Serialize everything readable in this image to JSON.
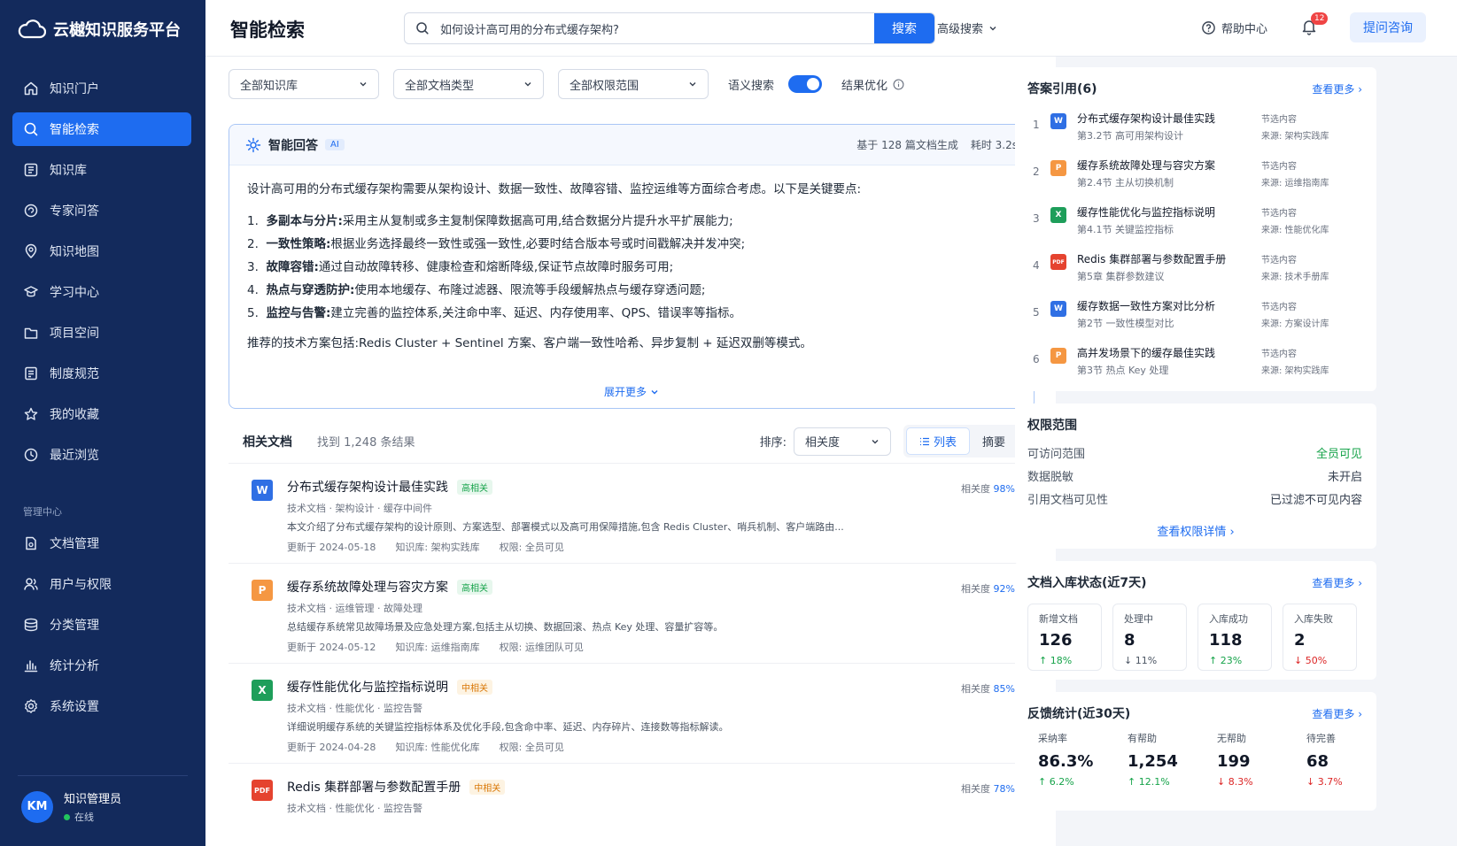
{
  "sidebar": {
    "logo": "云樾知识服务平台",
    "items": [
      {
        "label": "知识门户",
        "icon": "home-icon"
      },
      {
        "label": "智能检索",
        "icon": "search-icon",
        "active": true
      },
      {
        "label": "知识库",
        "icon": "library-icon"
      },
      {
        "label": "专家问答",
        "icon": "chat-icon"
      },
      {
        "label": "知识地图",
        "icon": "map-pin-icon"
      },
      {
        "label": "学习中心",
        "icon": "graduation-icon"
      },
      {
        "label": "项目空间",
        "icon": "folder-icon"
      },
      {
        "label": "制度规范",
        "icon": "document-icon"
      },
      {
        "label": "我的收藏",
        "icon": "star-icon"
      },
      {
        "label": "最近浏览",
        "icon": "clock-icon"
      }
    ],
    "admin_section": "管理中心",
    "admin_items": [
      {
        "label": "文档管理",
        "icon": "file-manage-icon"
      },
      {
        "label": "用户与权限",
        "icon": "users-icon"
      },
      {
        "label": "分类管理",
        "icon": "layers-icon"
      },
      {
        "label": "统计分析",
        "icon": "bar-chart-icon"
      },
      {
        "label": "系统设置",
        "icon": "gear-icon"
      }
    ],
    "user": {
      "initials": "KM",
      "name": "知识管理员",
      "status": "在线"
    }
  },
  "header": {
    "title": "智能检索",
    "search_value": "如何设计高可用的分布式缓存架构?",
    "search_button": "搜索",
    "advanced": "高级搜索",
    "help": "帮助中心",
    "notif_count": "12",
    "ask_button": "提问咨询"
  },
  "filters": {
    "kb": "全部知识库",
    "doc_type": "全部文档类型",
    "scope": "全部权限范围",
    "semantic": "语义搜索",
    "optimize": "结果优化"
  },
  "ai_answer": {
    "title": "智能回答",
    "tag": "AI",
    "basis": "基于 128 篇文档生成",
    "time": "耗时 3.2s",
    "intro": "设计高可用的分布式缓存架构需要从架构设计、数据一致性、故障容错、监控运维等方面综合考虑。以下是关键要点:",
    "points": [
      {
        "num": "1.",
        "head": "多副本与分片:",
        "text": "采用主从复制或多主复制保障数据高可用,结合数据分片提升水平扩展能力;"
      },
      {
        "num": "2.",
        "head": "一致性策略:",
        "text": "根据业务选择最终一致性或强一致性,必要时结合版本号或时间戳解决并发冲突;"
      },
      {
        "num": "3.",
        "head": "故障容错:",
        "text": "通过自动故障转移、健康检查和熔断降级,保证节点故障时服务可用;"
      },
      {
        "num": "4.",
        "head": "热点与穿透防护:",
        "text": "使用本地缓存、布隆过滤器、限流等手段缓解热点与缓存穿透问题;"
      },
      {
        "num": "5.",
        "head": "监控与告警:",
        "text": "建立完善的监控体系,关注命中率、延迟、内存使用率、QPS、错误率等指标。"
      }
    ],
    "summary": "推荐的技术方案包括:Redis Cluster + Sentinel 方案、客户端一致性哈希、异步复制 + 延迟双删等模式。",
    "expand": "展开更多"
  },
  "docs": {
    "title": "相关文档",
    "count": "找到 1,248 条结果",
    "sort_label": "排序:",
    "sort_value": "相关度",
    "view_list": "列表",
    "view_summary": "摘要",
    "rows": [
      {
        "type": "W",
        "color": "#2f6fe4",
        "title": "分布式缓存架构设计最佳实践",
        "rel": "高相关",
        "rel_level": "high",
        "tags": "技术文档 · 架构设计 · 缓存中间件",
        "desc": "本文介绍了分布式缓存架构的设计原则、方案选型、部署模式以及高可用保障措施,包含 Redis Cluster、哨兵机制、客户端路由...",
        "updated": "更新于 2024-05-18",
        "kb": "知识库: 架构实践库",
        "perm": "权限: 全员可见",
        "score_label": "相关度",
        "score": "98%"
      },
      {
        "type": "P",
        "color": "#f59742",
        "title": "缓存系统故障处理与容灾方案",
        "rel": "高相关",
        "rel_level": "high",
        "tags": "技术文档 · 运维管理 · 故障处理",
        "desc": "总结缓存系统常见故障场景及应急处理方案,包括主从切换、数据回滚、热点 Key 处理、容量扩容等。",
        "updated": "更新于 2024-05-12",
        "kb": "知识库: 运维指南库",
        "perm": "权限: 运维团队可见",
        "score_label": "相关度",
        "score": "92%"
      },
      {
        "type": "X",
        "color": "#1e9e5a",
        "title": "缓存性能优化与监控指标说明",
        "rel": "中相关",
        "rel_level": "mid",
        "tags": "技术文档 · 性能优化 · 监控告警",
        "desc": "详细说明缓存系统的关键监控指标体系及优化手段,包含命中率、延迟、内存碎片、连接数等指标解读。",
        "updated": "更新于 2024-04-28",
        "kb": "知识库: 性能优化库",
        "perm": "权限: 全员可见",
        "score_label": "相关度",
        "score": "85%"
      },
      {
        "type": "PDF",
        "color": "#e5432f",
        "title": "Redis 集群部署与参数配置手册",
        "rel": "中相关",
        "rel_level": "mid",
        "tags": "技术文档 · 性能优化 · 监控告警",
        "desc": "",
        "updated": "",
        "kb": "",
        "perm": "",
        "score_label": "相关度",
        "score": "78%"
      }
    ]
  },
  "citations": {
    "title": "答案引用(6)",
    "more": "查看更多",
    "items": [
      {
        "num": "1",
        "type": "W",
        "color": "#2f6fe4",
        "title": "分布式缓存架构设计最佳实践",
        "sub": "第3.2节 高可用架构设计",
        "label": "节选内容",
        "source": "来源: 架构实践库"
      },
      {
        "num": "2",
        "type": "P",
        "color": "#f59742",
        "title": "缓存系统故障处理与容灾方案",
        "sub": "第2.4节 主从切换机制",
        "label": "节选内容",
        "source": "来源: 运维指南库"
      },
      {
        "num": "3",
        "type": "X",
        "color": "#1e9e5a",
        "title": "缓存性能优化与监控指标说明",
        "sub": "第4.1节 关键监控指标",
        "label": "节选内容",
        "source": "来源: 性能优化库"
      },
      {
        "num": "4",
        "type": "PDF",
        "color": "#e5432f",
        "title": "Redis 集群部署与参数配置手册",
        "sub": "第5章 集群参数建议",
        "label": "节选内容",
        "source": "来源: 技术手册库"
      },
      {
        "num": "5",
        "type": "W",
        "color": "#2f6fe4",
        "title": "缓存数据一致性方案对比分析",
        "sub": "第2节 一致性模型对比",
        "label": "节选内容",
        "source": "来源: 方案设计库"
      },
      {
        "num": "6",
        "type": "P",
        "color": "#f59742",
        "title": "高并发场景下的缓存最佳实践",
        "sub": "第3节 热点 Key 处理",
        "label": "节选内容",
        "source": "来源: 架构实践库"
      }
    ]
  },
  "permission": {
    "title": "权限范围",
    "rows": [
      {
        "label": "可访问范围",
        "value": "全员可见",
        "ok": true
      },
      {
        "label": "数据脱敏",
        "value": "未开启"
      },
      {
        "label": "引用文档可见性",
        "value": "已过滤不可见内容"
      }
    ],
    "link": "查看权限详情"
  },
  "ingest": {
    "title": "文档入库状态(近7天)",
    "more": "查看更多",
    "stats": [
      {
        "label": "新增文档",
        "value": "126",
        "delta": "↑ 18%",
        "dir": "up"
      },
      {
        "label": "处理中",
        "value": "8",
        "delta": "↓ 11%",
        "dir": "down-gray"
      },
      {
        "label": "入库成功",
        "value": "118",
        "delta": "↑ 23%",
        "dir": "up"
      },
      {
        "label": "入库失败",
        "value": "2",
        "delta": "↓ 50%",
        "dir": "down"
      }
    ]
  },
  "feedback": {
    "title": "反馈统计(近30天)",
    "more": "查看更多",
    "stats": [
      {
        "label": "采纳率",
        "value": "86.3%",
        "delta": "↑ 6.2%",
        "dir": "up"
      },
      {
        "label": "有帮助",
        "value": "1,254",
        "delta": "↑ 12.1%",
        "dir": "up"
      },
      {
        "label": "无帮助",
        "value": "199",
        "delta": "↓ 8.3%",
        "dir": "down"
      },
      {
        "label": "待完善",
        "value": "68",
        "delta": "↓ 3.7%",
        "dir": "down"
      }
    ]
  },
  "colors": {
    "accent": "#1e6cf0",
    "sidebar": "#132a5c",
    "success": "#16a34a",
    "danger": "#dc2626"
  }
}
